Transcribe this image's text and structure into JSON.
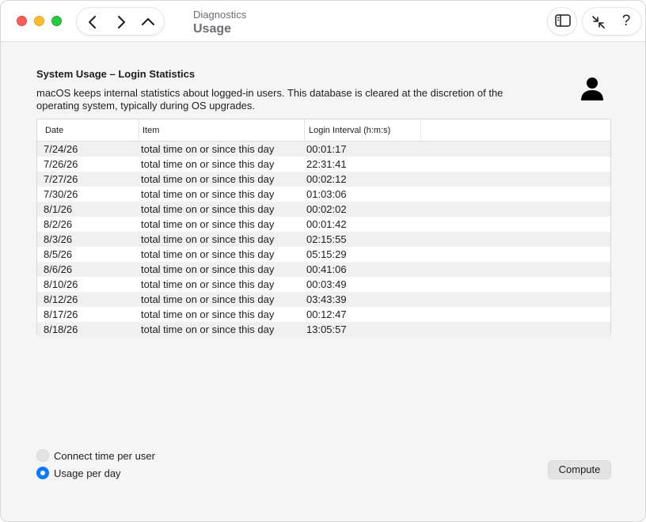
{
  "window": {
    "breadcrumb": "Diagnostics",
    "title": "Usage"
  },
  "toolbar": {
    "back_icon": "chevron-left-icon",
    "forward_icon": "chevron-right-icon",
    "up_icon": "chevron-up-icon",
    "sidebar_icon": "sidebar-icon",
    "shrink_icon": "arrows-inward-icon",
    "help_label": "?"
  },
  "content": {
    "section_title": "System Usage – Login Statistics",
    "description": "macOS keeps internal statistics about logged-in users. This database is cleared at the discretion of the operating system, typically during OS upgrades.",
    "user_icon": "person-icon"
  },
  "table": {
    "columns": [
      "Date",
      "Item",
      "Login Interval (h:m:s)"
    ],
    "rows": [
      {
        "date": "7/24/26",
        "item": "total time on or since this day",
        "interval": "00:01:17"
      },
      {
        "date": "7/26/26",
        "item": "total time on or since this day",
        "interval": "22:31:41"
      },
      {
        "date": "7/27/26",
        "item": "total time on or since this day",
        "interval": "00:02:12"
      },
      {
        "date": "7/30/26",
        "item": "total time on or since this day",
        "interval": "01:03:06"
      },
      {
        "date": "8/1/26",
        "item": "total time on or since this day",
        "interval": "00:02:02"
      },
      {
        "date": "8/2/26",
        "item": "total time on or since this day",
        "interval": "00:01:42"
      },
      {
        "date": "8/3/26",
        "item": "total time on or since this day",
        "interval": "02:15:55"
      },
      {
        "date": "8/5/26",
        "item": "total time on or since this day",
        "interval": "05:15:29"
      },
      {
        "date": "8/6/26",
        "item": "total time on or since this day",
        "interval": "00:41:06"
      },
      {
        "date": "8/10/26",
        "item": "total time on or since this day",
        "interval": "00:03:49"
      },
      {
        "date": "8/12/26",
        "item": "total time on or since this day",
        "interval": "03:43:39"
      },
      {
        "date": "8/17/26",
        "item": "total time on or since this day",
        "interval": "00:12:47"
      },
      {
        "date": "8/18/26",
        "item": "total time on or since this day",
        "interval": "13:05:57"
      }
    ]
  },
  "options": {
    "connect_time_label": "Connect time per user",
    "usage_per_day_label": "Usage per day",
    "selected": "Usage per day"
  },
  "actions": {
    "compute_label": "Compute"
  },
  "colors": {
    "accent": "#0a7aff",
    "close": "#ff5f57",
    "minimize": "#febc2e",
    "zoom": "#28c840"
  }
}
